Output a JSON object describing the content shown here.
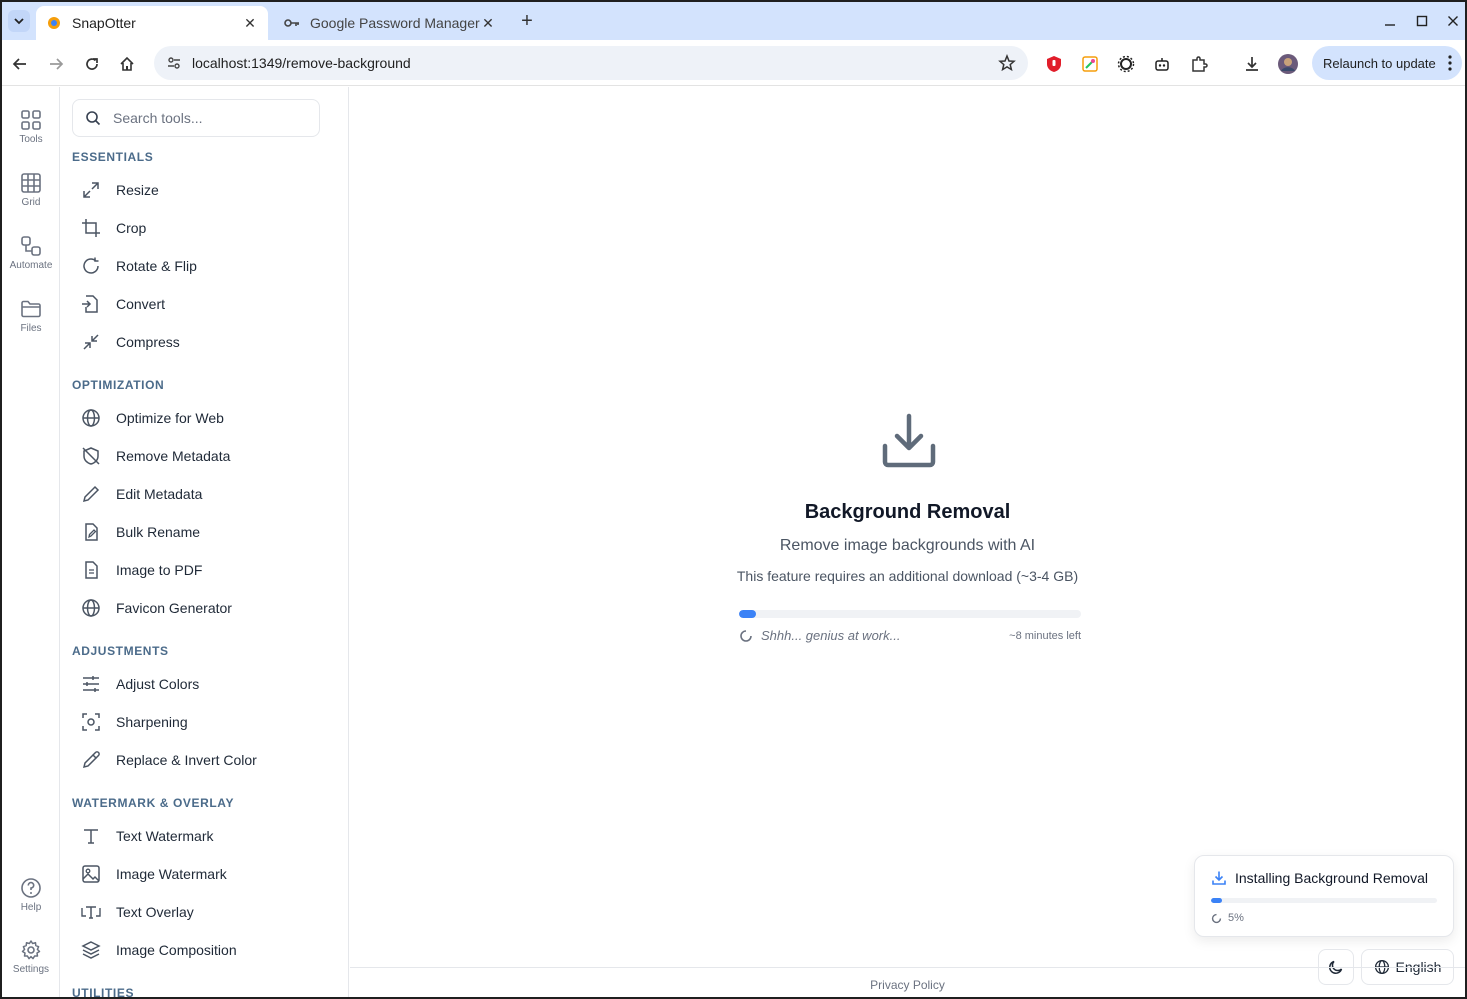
{
  "browser": {
    "tabs": [
      {
        "title": "SnapOtter",
        "active": true
      },
      {
        "title": "Google Password Manager",
        "active": false
      }
    ],
    "url": "localhost:1349/remove-background",
    "relaunch_label": "Relaunch to update"
  },
  "rail": {
    "items": [
      {
        "label": "Tools",
        "icon": "grid-2x2-icon"
      },
      {
        "label": "Grid",
        "icon": "grid-3x3-icon"
      },
      {
        "label": "Automate",
        "icon": "workflow-icon"
      },
      {
        "label": "Files",
        "icon": "folder-icon"
      }
    ],
    "bottom": [
      {
        "label": "Help",
        "icon": "help-circle-icon"
      },
      {
        "label": "Settings",
        "icon": "gear-icon"
      }
    ]
  },
  "sidebar": {
    "search_placeholder": "Search tools...",
    "sections": [
      {
        "title": "ESSENTIALS",
        "items": [
          "Resize",
          "Crop",
          "Rotate & Flip",
          "Convert",
          "Compress"
        ]
      },
      {
        "title": "OPTIMIZATION",
        "items": [
          "Optimize for Web",
          "Remove Metadata",
          "Edit Metadata",
          "Bulk Rename",
          "Image to PDF",
          "Favicon Generator"
        ]
      },
      {
        "title": "ADJUSTMENTS",
        "items": [
          "Adjust Colors",
          "Sharpening",
          "Replace & Invert Color"
        ]
      },
      {
        "title": "WATERMARK & OVERLAY",
        "items": [
          "Text Watermark",
          "Image Watermark",
          "Text Overlay",
          "Image Composition"
        ]
      },
      {
        "title": "UTILITIES",
        "items": []
      }
    ]
  },
  "main": {
    "title": "Background Removal",
    "subtitle": "Remove image backgrounds with AI",
    "note": "This feature requires an additional download (~3-4 GB)",
    "progress_fraction": 0.05,
    "status_message": "Shhh... genius at work...",
    "eta": "~8 minutes left",
    "footer_link": "Privacy Policy"
  },
  "toast": {
    "title": "Installing Background Removal",
    "percent_label": "5%",
    "progress_fraction": 0.05
  },
  "controls": {
    "language": "English"
  },
  "colors": {
    "accent": "#3b82f6",
    "section_heading": "#4b6b8a"
  }
}
